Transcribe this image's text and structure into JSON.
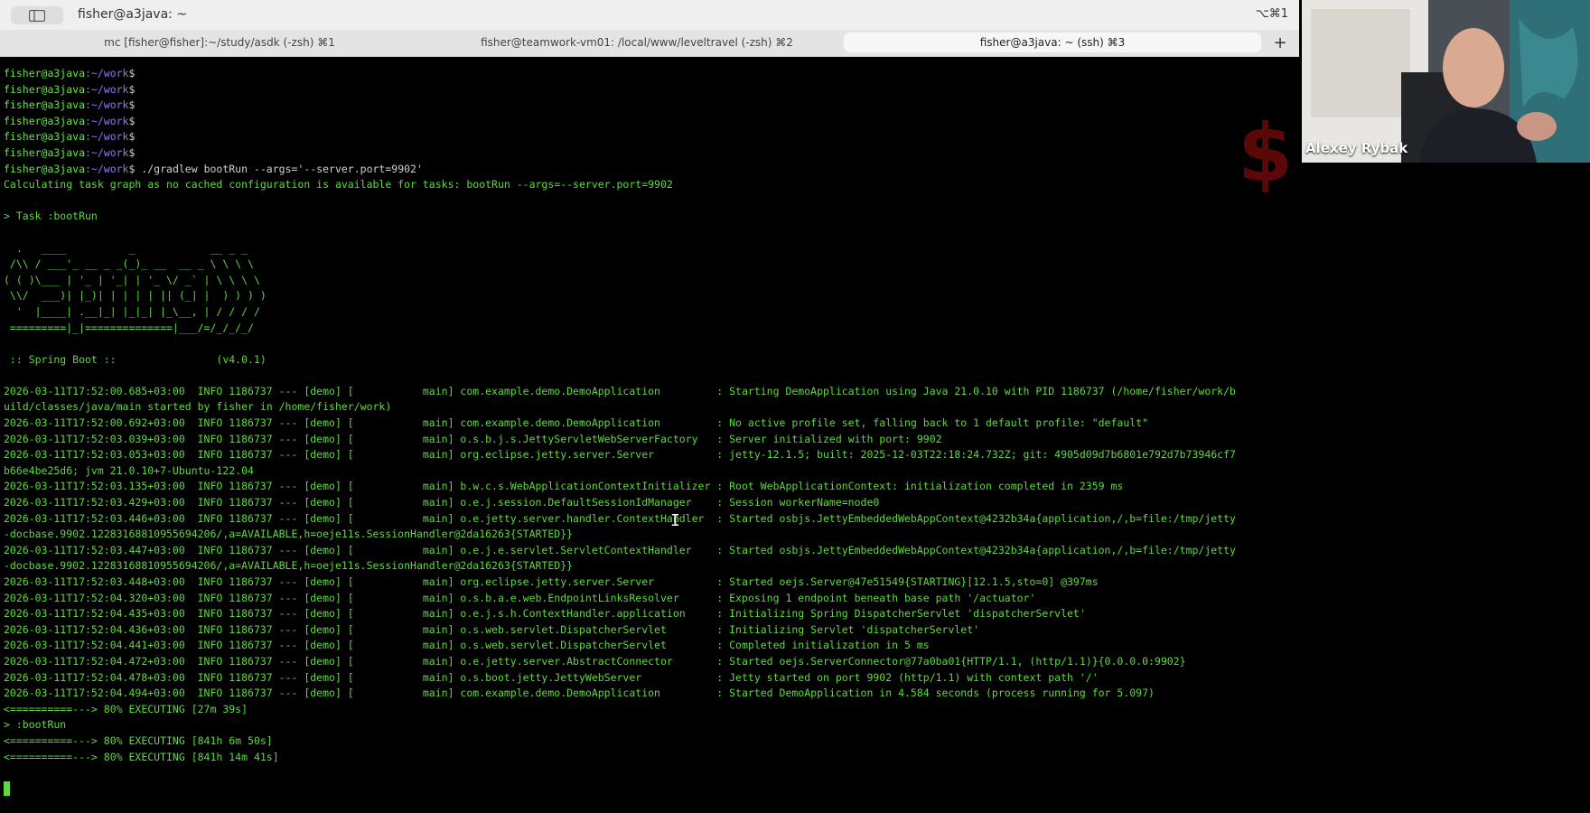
{
  "window": {
    "title": "fisher@a3java: ~",
    "shortcut": "⌥⌘1"
  },
  "tabs": [
    {
      "label": "mc [fisher@fisher]:~/study/asdk (-zsh) ⌘1",
      "active": false
    },
    {
      "label": "fisher@teamwork-vm01: /local/www/leveltravel (-zsh) ⌘2",
      "active": false
    },
    {
      "label": "fisher@a3java: ~ (ssh) ⌘3",
      "active": true
    }
  ],
  "new_tab": "+",
  "prompts": [
    {
      "user": "fisher@a3java",
      "path": ":~/work",
      "sign": "$",
      "cmd": ""
    },
    {
      "user": "fisher@a3java",
      "path": ":~/work",
      "sign": "$",
      "cmd": ""
    },
    {
      "user": "fisher@a3java",
      "path": ":~/work",
      "sign": "$",
      "cmd": ""
    },
    {
      "user": "fisher@a3java",
      "path": ":~/work",
      "sign": "$",
      "cmd": ""
    },
    {
      "user": "fisher@a3java",
      "path": ":~/work",
      "sign": "$",
      "cmd": ""
    },
    {
      "user": "fisher@a3java",
      "path": ":~/work",
      "sign": "$",
      "cmd": ""
    },
    {
      "user": "fisher@a3java",
      "path": ":~/work",
      "sign": "$",
      "cmd": " ./gradlew bootRun --args='--server.port=9902'"
    }
  ],
  "output": {
    "calc": "Calculating task graph as no cached configuration is available for tasks: bootRun --args=--server.port=9902",
    "task": "> Task :bootRun",
    "banner": [
      "  .   ____          _            __ _ _",
      " /\\\\ / ___'_ __ _ _(_)_ __  __ _ \\ \\ \\ \\",
      "( ( )\\___ | '_ | '_| | '_ \\/ _` | \\ \\ \\ \\",
      " \\\\/  ___)| |_)| | | | | || (_| |  ) ) ) )",
      "  '  |____| .__|_| |_|_| |_\\__, | / / / /",
      " =========|_|==============|___/=/_/_/_/"
    ],
    "spring": " :: Spring Boot ::                (v4.0.1)",
    "logs": [
      "2026-03-11T17:52:00.685+03:00  INFO 1186737 --- [demo] [           main] com.example.demo.DemoApplication         : Starting DemoApplication using Java 21.0.10 with PID 1186737 (/home/fisher/work/b",
      "uild/classes/java/main started by fisher in /home/fisher/work)",
      "2026-03-11T17:52:00.692+03:00  INFO 1186737 --- [demo] [           main] com.example.demo.DemoApplication         : No active profile set, falling back to 1 default profile: \"default\"",
      "2026-03-11T17:52:03.039+03:00  INFO 1186737 --- [demo] [           main] o.s.b.j.s.JettyServletWebServerFactory   : Server initialized with port: 9902",
      "2026-03-11T17:52:03.053+03:00  INFO 1186737 --- [demo] [           main] org.eclipse.jetty.server.Server          : jetty-12.1.5; built: 2025-12-03T22:18:24.732Z; git: 4905d09d7b6801e792d7b73946cf7",
      "b66e4be25d6; jvm 21.0.10+7-Ubuntu-122.04",
      "2026-03-11T17:52:03.135+03:00  INFO 1186737 --- [demo] [           main] b.w.c.s.WebApplicationContextInitializer : Root WebApplicationContext: initialization completed in 2359 ms",
      "2026-03-11T17:52:03.429+03:00  INFO 1186737 --- [demo] [           main] o.e.j.session.DefaultSessionIdManager    : Session workerName=node0",
      "2026-03-11T17:52:03.446+03:00  INFO 1186737 --- [demo] [           main] o.e.jetty.server.handler.ContextHandler  : Started osbjs.JettyEmbeddedWebAppContext@4232b34a{application,/,b=file:/tmp/jetty",
      "-docbase.9902.12283168810955694206/,a=AVAILABLE,h=oeje11s.SessionHandler@2da16263{STARTED}}",
      "2026-03-11T17:52:03.447+03:00  INFO 1186737 --- [demo] [           main] o.e.j.e.servlet.ServletContextHandler    : Started osbjs.JettyEmbeddedWebAppContext@4232b34a{application,/,b=file:/tmp/jetty",
      "-docbase.9902.12283168810955694206/,a=AVAILABLE,h=oeje11s.SessionHandler@2da16263{STARTED}}",
      "2026-03-11T17:52:03.448+03:00  INFO 1186737 --- [demo] [           main] org.eclipse.jetty.server.Server          : Started oejs.Server@47e51549{STARTING}[12.1.5,sto=0] @397ms",
      "2026-03-11T17:52:04.320+03:00  INFO 1186737 --- [demo] [           main] o.s.b.a.e.web.EndpointLinksResolver      : Exposing 1 endpoint beneath base path '/actuator'",
      "2026-03-11T17:52:04.435+03:00  INFO 1186737 --- [demo] [           main] o.e.j.s.h.ContextHandler.application     : Initializing Spring DispatcherServlet 'dispatcherServlet'",
      "2026-03-11T17:52:04.436+03:00  INFO 1186737 --- [demo] [           main] o.s.web.servlet.DispatcherServlet        : Initializing Servlet 'dispatcherServlet'",
      "2026-03-11T17:52:04.441+03:00  INFO 1186737 --- [demo] [           main] o.s.web.servlet.DispatcherServlet        : Completed initialization in 5 ms",
      "2026-03-11T17:52:04.472+03:00  INFO 1186737 --- [demo] [           main] o.e.jetty.server.AbstractConnector       : Started oejs.ServerConnector@77a0ba01{HTTP/1.1, (http/1.1)}{0.0.0.0:9902}",
      "2026-03-11T17:52:04.478+03:00  INFO 1186737 --- [demo] [           main] o.s.boot.jetty.JettyWebServer            : Jetty started on port 9902 (http/1.1) with context path '/'",
      "2026-03-11T17:52:04.494+03:00  INFO 1186737 --- [demo] [           main] com.example.demo.DemoApplication         : Started DemoApplication in 4.584 seconds (process running for 5.097)"
    ],
    "progress1": "<==========---> 80% EXECUTING [27m 39s]",
    "bootrun": "> :bootRun",
    "progress2": "<==========---> 80% EXECUTING [841h 6m 50s]",
    "progress3": "<==========---> 80% EXECUTING [841h 14m 41s]"
  },
  "logo": "$",
  "video": {
    "participant": "Alexey Rybak"
  }
}
